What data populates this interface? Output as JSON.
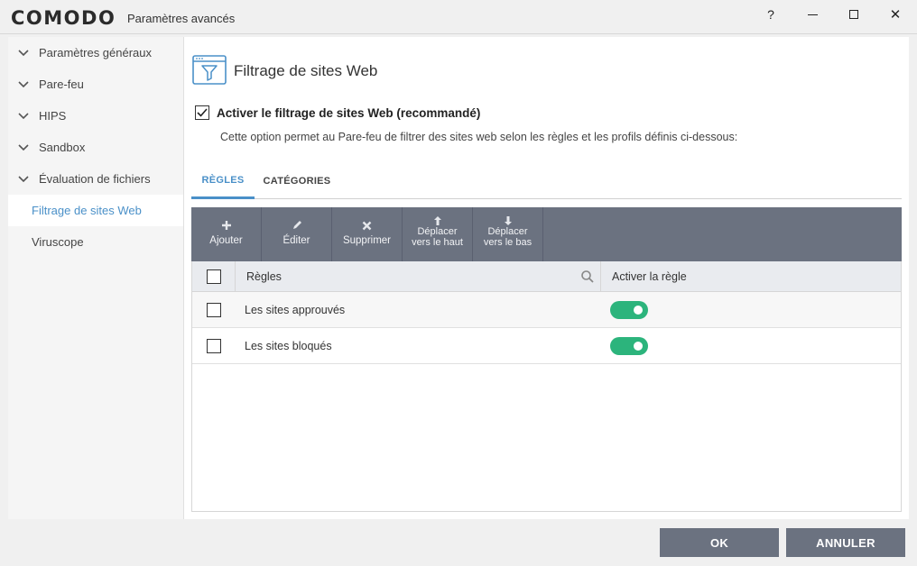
{
  "titlebar": {
    "logo": "COMODO",
    "title": "Paramètres avancés",
    "help": "?",
    "close": "✕"
  },
  "sidebar": {
    "items": [
      {
        "label": "Paramètres généraux",
        "expandable": true
      },
      {
        "label": "Pare-feu",
        "expandable": true
      },
      {
        "label": "HIPS",
        "expandable": true
      },
      {
        "label": "Sandbox",
        "expandable": true
      },
      {
        "label": "Évaluation de fichiers",
        "expandable": true
      },
      {
        "label": "Filtrage de sites Web",
        "active": true
      },
      {
        "label": "Viruscope"
      }
    ]
  },
  "page": {
    "title": "Filtrage de sites Web",
    "icon": "filter-window-icon",
    "enable_label": "Activer le filtrage de sites Web (recommandé)",
    "enable_checked": true,
    "description": "Cette option permet au Pare-feu de filtrer des sites web selon les règles et les profils définis ci-dessous:"
  },
  "tabs": [
    {
      "label": "RÈGLES",
      "active": true
    },
    {
      "label": "CATÉGORIES",
      "active": false
    }
  ],
  "toolbar": {
    "add": {
      "label": "Ajouter",
      "icon": "plus-icon"
    },
    "edit": {
      "label": "Éditer",
      "icon": "pencil-icon"
    },
    "delete": {
      "label": "Supprimer",
      "icon": "x-icon"
    },
    "move_up": {
      "line1": "Déplacer",
      "line2": "vers le haut",
      "icon": "arrow-up-icon"
    },
    "move_down": {
      "line1": "Déplacer",
      "line2": "vers le bas",
      "icon": "arrow-down-icon"
    }
  },
  "table": {
    "headers": {
      "rules": "Règles",
      "enable": "Activer la règle"
    },
    "rows": [
      {
        "name": "Les sites approuvés",
        "enabled": true
      },
      {
        "name": "Les sites bloqués",
        "enabled": true
      }
    ]
  },
  "footer": {
    "ok": "OK",
    "cancel": "ANNULER"
  },
  "colors": {
    "accent": "#4a90c8",
    "toolbar": "#6b7280",
    "toggle_on": "#2cb47c"
  }
}
